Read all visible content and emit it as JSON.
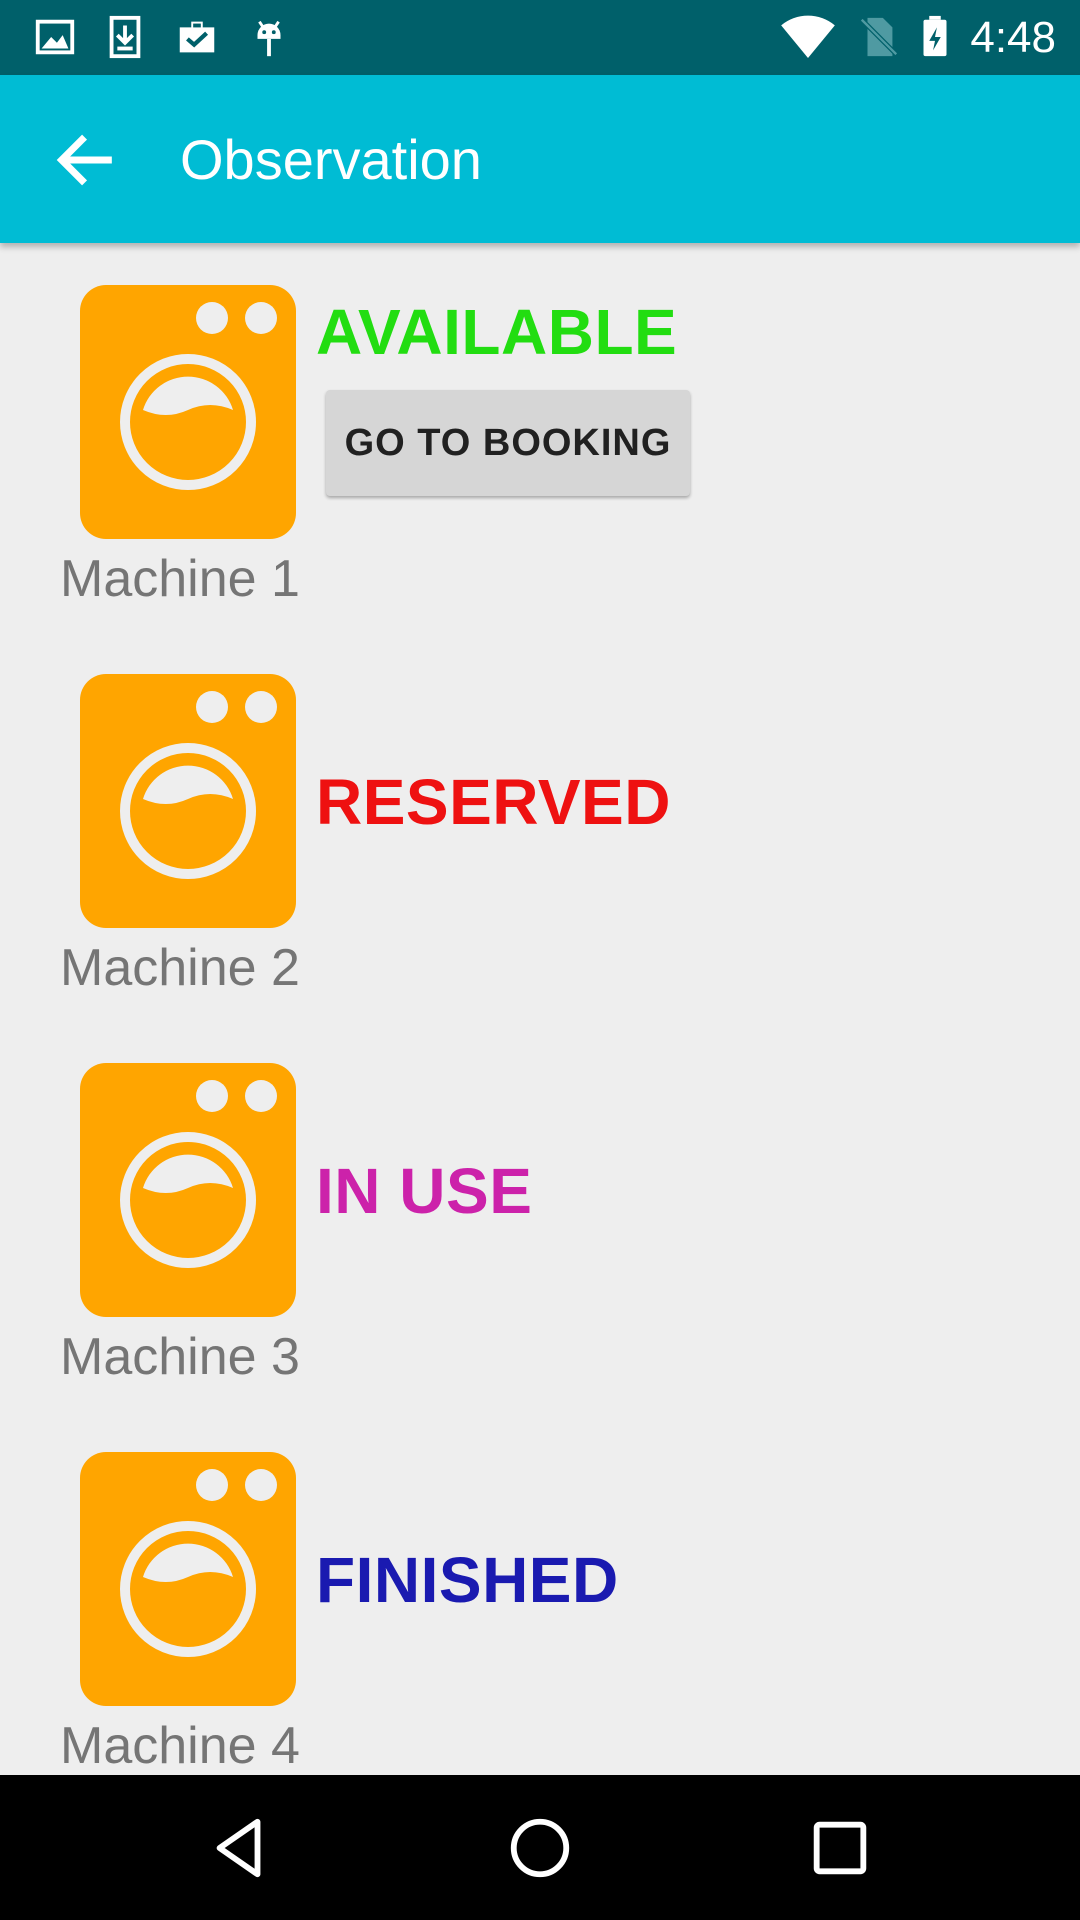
{
  "status_bar": {
    "time": "4:48",
    "left_icons": [
      "image-icon",
      "download-icon",
      "briefcase-check-icon",
      "android-icon"
    ],
    "right_icons": [
      "wifi-icon",
      "no-sim-icon",
      "battery-charging-icon"
    ],
    "background": "#00606a"
  },
  "app_bar": {
    "title": "Observation",
    "back_icon": "arrow-back-icon",
    "background": "#00bcd4"
  },
  "machines": [
    {
      "label": "Machine 1",
      "status": "AVAILABLE",
      "status_color": "#22dd11",
      "button_label": "GO TO BOOKING",
      "icon": "washing-machine-icon"
    },
    {
      "label": "Machine 2",
      "status": "RESERVED",
      "status_color": "#ee1111",
      "icon": "washing-machine-icon"
    },
    {
      "label": "Machine 3",
      "status": "IN USE",
      "status_color": "#cc22aa",
      "icon": "washing-machine-icon"
    },
    {
      "label": "Machine 4",
      "status": "FINISHED",
      "status_color": "#1a1ab0",
      "icon": "washing-machine-icon"
    }
  ],
  "colors": {
    "machine_icon": "#ffa500",
    "background": "#eeeeee",
    "label_text": "#757575"
  },
  "nav_bar": {
    "icons": [
      "back-triangle-icon",
      "home-circle-icon",
      "recents-square-icon"
    ]
  }
}
